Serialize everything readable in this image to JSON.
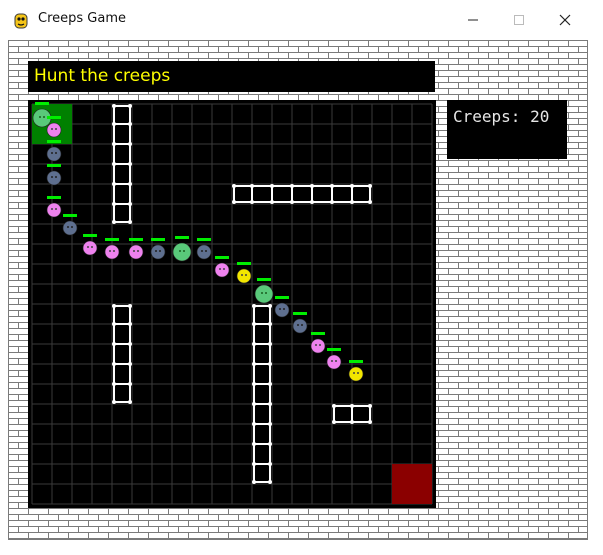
{
  "window": {
    "title": "Creeps Game",
    "icon": "pygame-snake-icon",
    "minimize_icon": "minimize-icon",
    "maximize_icon": "maximize-icon",
    "close_icon": "close-icon"
  },
  "header": {
    "message": "Hunt the creeps"
  },
  "score": {
    "text": "Creeps: 20"
  },
  "colors": {
    "header_text": "#ffff00",
    "score_text": "#e6e6e6",
    "grid_line": "#3a3a3a",
    "wall": "#ffffff",
    "entrance": "#008000",
    "exit": "#8b0000",
    "health_bar": "#00ee00",
    "brick_mortar": "#7a7a7a",
    "brick": "#ffffff"
  },
  "game": {
    "grid_cols": 20,
    "grid_rows": 20,
    "entrance_cell": [
      0,
      0
    ],
    "exit_cell": [
      18,
      18
    ],
    "walls": [
      {
        "orientation": "vertical",
        "col": 4,
        "row_start": 0,
        "row_end": 6
      },
      {
        "orientation": "horizontal",
        "row": 4,
        "col_start": 10,
        "col_end": 17
      },
      {
        "orientation": "vertical",
        "col": 4,
        "row_start": 10,
        "row_end": 15
      },
      {
        "orientation": "vertical",
        "col": 11,
        "row_start": 10,
        "row_end": 19
      },
      {
        "orientation": "horizontal",
        "row": 15,
        "col_start": 15,
        "col_end": 17
      }
    ],
    "creeps": [
      {
        "type": "green",
        "grid": [
          0.5,
          0.7
        ]
      },
      {
        "type": "pink",
        "grid": [
          1.1,
          1.3
        ]
      },
      {
        "type": "blue",
        "grid": [
          1.1,
          2.5
        ]
      },
      {
        "type": "blue",
        "grid": [
          1.1,
          3.7
        ]
      },
      {
        "type": "pink",
        "grid": [
          1.1,
          5.3
        ]
      },
      {
        "type": "blue",
        "grid": [
          1.9,
          6.2
        ]
      },
      {
        "type": "pink",
        "grid": [
          2.9,
          7.2
        ]
      },
      {
        "type": "pink",
        "grid": [
          4.0,
          7.4
        ]
      },
      {
        "type": "pink",
        "grid": [
          5.2,
          7.4
        ]
      },
      {
        "type": "blue",
        "grid": [
          6.3,
          7.4
        ]
      },
      {
        "type": "green",
        "grid": [
          7.5,
          7.4
        ]
      },
      {
        "type": "blue",
        "grid": [
          8.6,
          7.4
        ]
      },
      {
        "type": "pink",
        "grid": [
          9.5,
          8.3
        ]
      },
      {
        "type": "yellow",
        "grid": [
          10.6,
          8.6
        ]
      },
      {
        "type": "green",
        "grid": [
          11.6,
          9.5
        ]
      },
      {
        "type": "blue",
        "grid": [
          12.5,
          10.3
        ]
      },
      {
        "type": "blue",
        "grid": [
          13.4,
          11.1
        ]
      },
      {
        "type": "pink",
        "grid": [
          14.3,
          12.1
        ]
      },
      {
        "type": "pink",
        "grid": [
          15.1,
          12.9
        ]
      },
      {
        "type": "yellow",
        "grid": [
          16.2,
          13.5
        ]
      }
    ]
  }
}
